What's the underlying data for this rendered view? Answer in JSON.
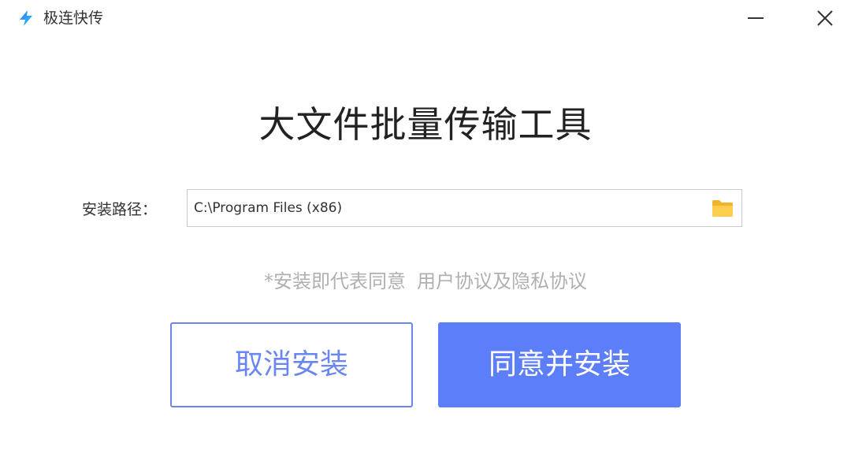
{
  "window": {
    "title": "极连快传",
    "accent_color": "#5d7ef9",
    "icons": {
      "logo": "lightning-bolt-icon",
      "minimize": "minimize-icon",
      "close": "close-icon",
      "folder": "folder-icon"
    }
  },
  "main": {
    "heading": "大文件批量传输工具",
    "install_path": {
      "label": "安装路径：",
      "value": "C:\\Program Files (x86)"
    },
    "agreement": {
      "prefix": "*安装即代表同意",
      "link": "用户协议及隐私协议"
    },
    "buttons": {
      "cancel_label": "取消安装",
      "install_label": "同意并安装"
    }
  }
}
